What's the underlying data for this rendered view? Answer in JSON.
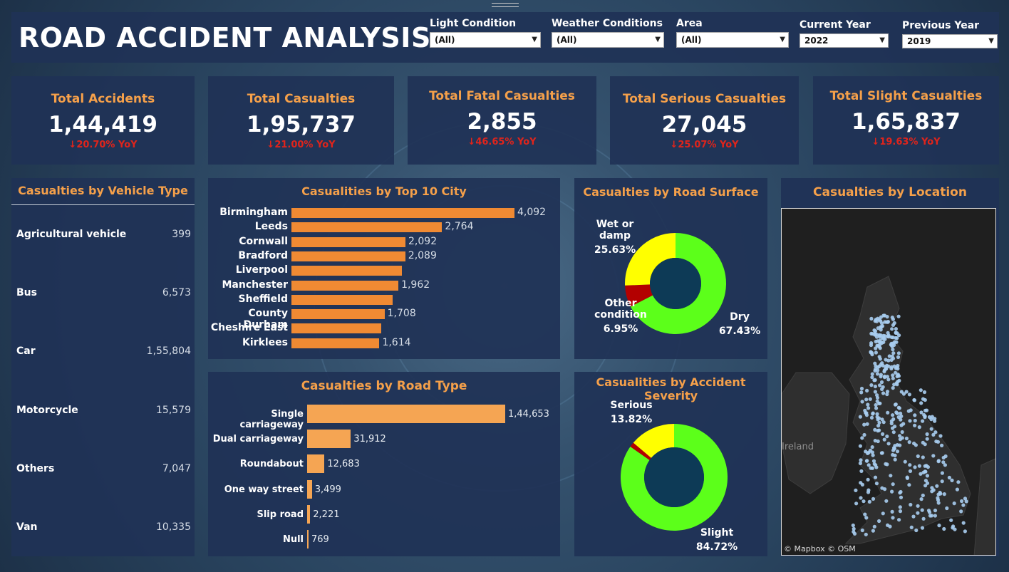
{
  "title": "ROAD ACCIDENT ANALYSIS",
  "filters": [
    {
      "label": "Light Condition",
      "value": "(All)"
    },
    {
      "label": "Weather Conditions",
      "value": "(All)"
    },
    {
      "label": "Area",
      "value": "(All)"
    },
    {
      "label": "Current Year",
      "value": "2022"
    },
    {
      "label": "Previous Year",
      "value": "2019"
    }
  ],
  "kpis": [
    {
      "label": "Total Accidents",
      "value": "1,44,419",
      "yoy": "↓20.70% YoY"
    },
    {
      "label": "Total Casualties",
      "value": "1,95,737",
      "yoy": "↓21.00% YoY"
    },
    {
      "label": "Total Fatal Casualties",
      "value": "2,855",
      "yoy": "↓46.65% YoY"
    },
    {
      "label": "Total Serious Casualties",
      "value": "27,045",
      "yoy": "↓25.07% YoY"
    },
    {
      "label": "Total Slight Casualties",
      "value": "1,65,837",
      "yoy": "↓19.63% YoY"
    }
  ],
  "vehicle": {
    "title": "Casualties by Vehicle Type",
    "rows": [
      {
        "name": "Agricultural vehicle",
        "value": "399"
      },
      {
        "name": "Bus",
        "value": "6,573"
      },
      {
        "name": "Car",
        "value": "1,55,804"
      },
      {
        "name": "Motorcycle",
        "value": "15,579"
      },
      {
        "name": "Others",
        "value": "7,047"
      },
      {
        "name": "Van",
        "value": "10,335"
      }
    ]
  },
  "city": {
    "title": "Casualities by Top 10 City",
    "labels": [
      "Birmingham",
      "Leeds",
      "Cornwall",
      "Bradford",
      "Liverpool",
      "Manchester",
      "Sheffield",
      "County Durham",
      "Cheshire East",
      "Kirklees"
    ],
    "value_labels": [
      "4,092",
      "2,764",
      "2,092",
      "2,089",
      "",
      "1,962",
      "",
      "1,708",
      "",
      "1,614"
    ]
  },
  "road_type": {
    "title": "Casualties by Road Type",
    "labels": [
      "Single carriageway",
      "Dual carriageway",
      "Roundabout",
      "One way street",
      "Slip road",
      "Null"
    ],
    "value_labels": [
      "1,44,653",
      "31,912",
      "12,683",
      "3,499",
      "2,221",
      "769"
    ]
  },
  "surface": {
    "title": "Casualties by Road Surface",
    "labels": [
      "Wet or damp",
      "25.63%",
      "Other condition",
      "6.95%",
      "Dry",
      "67.43%"
    ]
  },
  "severity": {
    "title": "Casualities by Accident Severity",
    "labels": [
      "Serious",
      "13.82%",
      "Slight",
      "84.72%"
    ]
  },
  "location": {
    "title": "Casualties by Location",
    "credit": "© Mapbox © OSM",
    "map_text": "Ireland"
  },
  "colors": {
    "accent": "#f5a04a",
    "bar": "#f08a33",
    "yoy_down": "#e0241b",
    "donut_green": "#5cff1a",
    "donut_yellow": "#ffff00",
    "donut_red": "#b30000",
    "donut_hole": "#0d3a56"
  },
  "chart_data": [
    {
      "type": "bar",
      "title": "Casualities by Top 10 City",
      "categories": [
        "Birmingham",
        "Leeds",
        "Cornwall",
        "Bradford",
        "Liverpool",
        "Manchester",
        "Sheffield",
        "County Durham",
        "Cheshire East",
        "Kirklees"
      ],
      "values": [
        4092,
        2764,
        2092,
        2089,
        2030,
        1962,
        1850,
        1708,
        1650,
        1614
      ]
    },
    {
      "type": "bar",
      "title": "Casualties by Road Type",
      "categories": [
        "Single carriageway",
        "Dual carriageway",
        "Roundabout",
        "One way street",
        "Slip road",
        "Null"
      ],
      "values": [
        144653,
        31912,
        12683,
        3499,
        2221,
        769
      ]
    },
    {
      "type": "pie",
      "title": "Casualties by Road Surface",
      "categories": [
        "Dry",
        "Other condition",
        "Wet or damp"
      ],
      "values": [
        67.43,
        6.95,
        25.63
      ]
    },
    {
      "type": "pie",
      "title": "Casualities by Accident Severity",
      "categories": [
        "Slight",
        "Fatal",
        "Serious"
      ],
      "values": [
        84.72,
        1.46,
        13.82
      ]
    }
  ]
}
